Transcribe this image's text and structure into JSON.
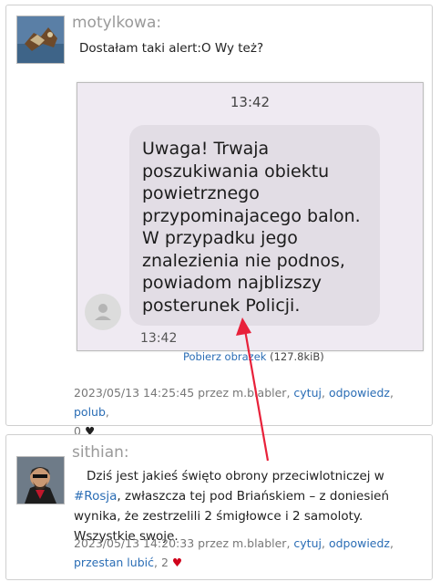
{
  "posts": [
    {
      "author": "motylkowa:",
      "text": "Dostałam taki alert:O Wy też?",
      "image": {
        "time_top": "13:42",
        "sms_text": "Uwaga! Trwaja poszukiwania obiektu powietrznego przypominajacego balon. W przypadku jego znalezienia nie podnos, powiadom najblizszy posterunek Policji.",
        "time_bottom": "13:42"
      },
      "download_label": "Pobierz obrazek",
      "download_size": "(127.8kiB)",
      "meta": {
        "timestamp": "2023/05/13 14:25:45 przez m.blabler,",
        "cite": "cytuj",
        "reply": "odpowiedz",
        "like": "polub",
        "likes": "0"
      }
    },
    {
      "author": "sithian:",
      "text_before": "Dziś jest jakieś święto obrony przeciwlotniczej w ",
      "hashtag": "#Rosja",
      "text_after": ", zwłaszcza tej pod Briańskiem – z doniesień wynika, że zestrzelili 2 śmigłowce i 2 samoloty. Wszystkie swoje.",
      "meta": {
        "timestamp": "2023/05/13 14:20:33 przez m.blabler,",
        "cite": "cytuj",
        "reply": "odpowiedz",
        "unlike": "przestan lubić",
        "likes": "2"
      }
    }
  ],
  "colors": {
    "link": "#2a6db5",
    "heart_active": "#d0021b",
    "arrow": "#e8213a"
  },
  "icons": {
    "heart": "♥",
    "arrow": "red-arrow-annotation"
  }
}
